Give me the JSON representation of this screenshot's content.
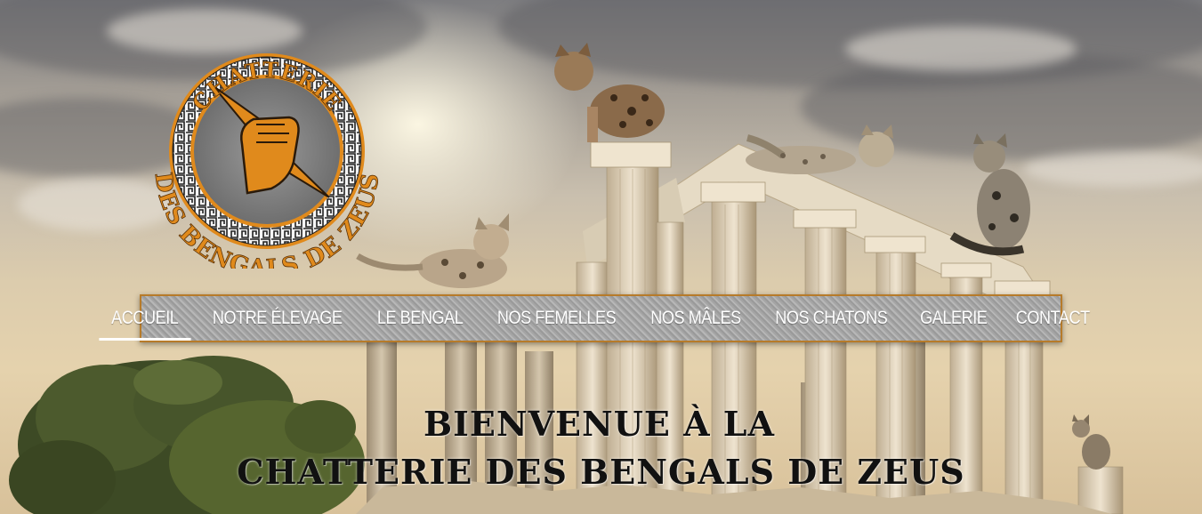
{
  "logo": {
    "top_text": "CHATTERIE",
    "bottom_text": "DES BENGALS DE ZEUS"
  },
  "nav": {
    "items": [
      {
        "label": "ACCUEIL",
        "active": true
      },
      {
        "label": "NOTRE ÉLEVAGE",
        "active": false
      },
      {
        "label": "LE BENGAL",
        "active": false
      },
      {
        "label": "NOS FEMELLES",
        "active": false
      },
      {
        "label": "NOS MÂLES",
        "active": false
      },
      {
        "label": "NOS CHATONS",
        "active": false
      },
      {
        "label": "GALERIE",
        "active": false
      },
      {
        "label": "CONTACT",
        "active": false
      }
    ]
  },
  "hero": {
    "title_line1": "BIENVENUE À LA",
    "title_line2": "CHATTERIE DES BENGALS DE ZEUS"
  },
  "colors": {
    "accent": "#e08a1c",
    "nav_border": "#b77b2a"
  }
}
